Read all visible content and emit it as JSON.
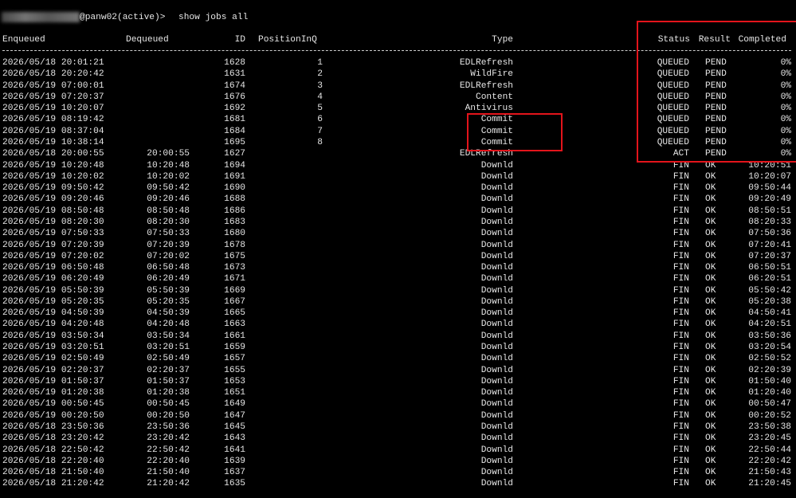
{
  "prompt": {
    "host_suffix": "@panw02(active)> ",
    "command": "show jobs all"
  },
  "headers": {
    "enqueued": "Enqueued",
    "dequeued": "Dequeued",
    "id": "ID",
    "position": "PositionInQ",
    "type": "Type",
    "status": "Status",
    "result": "Result",
    "completed": "Completed"
  },
  "separator": "------------------------------------------------------------------------------------------------------------------------------------",
  "colors": {
    "background": "#000000",
    "text": "#e6e6e6",
    "highlight_box": "#e3141b"
  },
  "rows": [
    {
      "enqueued": "2026/05/18 20:01:21",
      "dequeued": "",
      "id": "1628",
      "position": "1",
      "type": "EDLRefresh",
      "status": "QUEUED",
      "result": "PEND",
      "completed": "0%"
    },
    {
      "enqueued": "2026/05/18 20:20:42",
      "dequeued": "",
      "id": "1631",
      "position": "2",
      "type": "WildFire",
      "status": "QUEUED",
      "result": "PEND",
      "completed": "0%"
    },
    {
      "enqueued": "2026/05/19 07:00:01",
      "dequeued": "",
      "id": "1674",
      "position": "3",
      "type": "EDLRefresh",
      "status": "QUEUED",
      "result": "PEND",
      "completed": "0%"
    },
    {
      "enqueued": "2026/05/19 07:20:37",
      "dequeued": "",
      "id": "1676",
      "position": "4",
      "type": "Content",
      "status": "QUEUED",
      "result": "PEND",
      "completed": "0%"
    },
    {
      "enqueued": "2026/05/19 10:20:07",
      "dequeued": "",
      "id": "1692",
      "position": "5",
      "type": "Antivirus",
      "status": "QUEUED",
      "result": "PEND",
      "completed": "0%"
    },
    {
      "enqueued": "2026/05/19 08:19:42",
      "dequeued": "",
      "id": "1681",
      "position": "6",
      "type": "Commit",
      "status": "QUEUED",
      "result": "PEND",
      "completed": "0%"
    },
    {
      "enqueued": "2026/05/19 08:37:04",
      "dequeued": "",
      "id": "1684",
      "position": "7",
      "type": "Commit",
      "status": "QUEUED",
      "result": "PEND",
      "completed": "0%"
    },
    {
      "enqueued": "2026/05/19 10:38:14",
      "dequeued": "",
      "id": "1695",
      "position": "8",
      "type": "Commit",
      "status": "QUEUED",
      "result": "PEND",
      "completed": "0%"
    },
    {
      "enqueued": "2026/05/18 20:00:55",
      "dequeued": "20:00:55",
      "id": "1627",
      "position": "",
      "type": "EDLRefresh",
      "status": "ACT",
      "result": "PEND",
      "completed": "0%"
    },
    {
      "enqueued": "2026/05/19 10:20:48",
      "dequeued": "10:20:48",
      "id": "1694",
      "position": "",
      "type": "Downld",
      "status": "FIN",
      "result": "OK",
      "completed": "10:20:51"
    },
    {
      "enqueued": "2026/05/19 10:20:02",
      "dequeued": "10:20:02",
      "id": "1691",
      "position": "",
      "type": "Downld",
      "status": "FIN",
      "result": "OK",
      "completed": "10:20:07"
    },
    {
      "enqueued": "2026/05/19 09:50:42",
      "dequeued": "09:50:42",
      "id": "1690",
      "position": "",
      "type": "Downld",
      "status": "FIN",
      "result": "OK",
      "completed": "09:50:44"
    },
    {
      "enqueued": "2026/05/19 09:20:46",
      "dequeued": "09:20:46",
      "id": "1688",
      "position": "",
      "type": "Downld",
      "status": "FIN",
      "result": "OK",
      "completed": "09:20:49"
    },
    {
      "enqueued": "2026/05/19 08:50:48",
      "dequeued": "08:50:48",
      "id": "1686",
      "position": "",
      "type": "Downld",
      "status": "FIN",
      "result": "OK",
      "completed": "08:50:51"
    },
    {
      "enqueued": "2026/05/19 08:20:30",
      "dequeued": "08:20:30",
      "id": "1683",
      "position": "",
      "type": "Downld",
      "status": "FIN",
      "result": "OK",
      "completed": "08:20:33"
    },
    {
      "enqueued": "2026/05/19 07:50:33",
      "dequeued": "07:50:33",
      "id": "1680",
      "position": "",
      "type": "Downld",
      "status": "FIN",
      "result": "OK",
      "completed": "07:50:36"
    },
    {
      "enqueued": "2026/05/19 07:20:39",
      "dequeued": "07:20:39",
      "id": "1678",
      "position": "",
      "type": "Downld",
      "status": "FIN",
      "result": "OK",
      "completed": "07:20:41"
    },
    {
      "enqueued": "2026/05/19 07:20:02",
      "dequeued": "07:20:02",
      "id": "1675",
      "position": "",
      "type": "Downld",
      "status": "FIN",
      "result": "OK",
      "completed": "07:20:37"
    },
    {
      "enqueued": "2026/05/19 06:50:48",
      "dequeued": "06:50:48",
      "id": "1673",
      "position": "",
      "type": "Downld",
      "status": "FIN",
      "result": "OK",
      "completed": "06:50:51"
    },
    {
      "enqueued": "2026/05/19 06:20:49",
      "dequeued": "06:20:49",
      "id": "1671",
      "position": "",
      "type": "Downld",
      "status": "FIN",
      "result": "OK",
      "completed": "06:20:51"
    },
    {
      "enqueued": "2026/05/19 05:50:39",
      "dequeued": "05:50:39",
      "id": "1669",
      "position": "",
      "type": "Downld",
      "status": "FIN",
      "result": "OK",
      "completed": "05:50:42"
    },
    {
      "enqueued": "2026/05/19 05:20:35",
      "dequeued": "05:20:35",
      "id": "1667",
      "position": "",
      "type": "Downld",
      "status": "FIN",
      "result": "OK",
      "completed": "05:20:38"
    },
    {
      "enqueued": "2026/05/19 04:50:39",
      "dequeued": "04:50:39",
      "id": "1665",
      "position": "",
      "type": "Downld",
      "status": "FIN",
      "result": "OK",
      "completed": "04:50:41"
    },
    {
      "enqueued": "2026/05/19 04:20:48",
      "dequeued": "04:20:48",
      "id": "1663",
      "position": "",
      "type": "Downld",
      "status": "FIN",
      "result": "OK",
      "completed": "04:20:51"
    },
    {
      "enqueued": "2026/05/19 03:50:34",
      "dequeued": "03:50:34",
      "id": "1661",
      "position": "",
      "type": "Downld",
      "status": "FIN",
      "result": "OK",
      "completed": "03:50:36"
    },
    {
      "enqueued": "2026/05/19 03:20:51",
      "dequeued": "03:20:51",
      "id": "1659",
      "position": "",
      "type": "Downld",
      "status": "FIN",
      "result": "OK",
      "completed": "03:20:54"
    },
    {
      "enqueued": "2026/05/19 02:50:49",
      "dequeued": "02:50:49",
      "id": "1657",
      "position": "",
      "type": "Downld",
      "status": "FIN",
      "result": "OK",
      "completed": "02:50:52"
    },
    {
      "enqueued": "2026/05/19 02:20:37",
      "dequeued": "02:20:37",
      "id": "1655",
      "position": "",
      "type": "Downld",
      "status": "FIN",
      "result": "OK",
      "completed": "02:20:39"
    },
    {
      "enqueued": "2026/05/19 01:50:37",
      "dequeued": "01:50:37",
      "id": "1653",
      "position": "",
      "type": "Downld",
      "status": "FIN",
      "result": "OK",
      "completed": "01:50:40"
    },
    {
      "enqueued": "2026/05/19 01:20:38",
      "dequeued": "01:20:38",
      "id": "1651",
      "position": "",
      "type": "Downld",
      "status": "FIN",
      "result": "OK",
      "completed": "01:20:40"
    },
    {
      "enqueued": "2026/05/19 00:50:45",
      "dequeued": "00:50:45",
      "id": "1649",
      "position": "",
      "type": "Downld",
      "status": "FIN",
      "result": "OK",
      "completed": "00:50:47"
    },
    {
      "enqueued": "2026/05/19 00:20:50",
      "dequeued": "00:20:50",
      "id": "1647",
      "position": "",
      "type": "Downld",
      "status": "FIN",
      "result": "OK",
      "completed": "00:20:52"
    },
    {
      "enqueued": "2026/05/18 23:50:36",
      "dequeued": "23:50:36",
      "id": "1645",
      "position": "",
      "type": "Downld",
      "status": "FIN",
      "result": "OK",
      "completed": "23:50:38"
    },
    {
      "enqueued": "2026/05/18 23:20:42",
      "dequeued": "23:20:42",
      "id": "1643",
      "position": "",
      "type": "Downld",
      "status": "FIN",
      "result": "OK",
      "completed": "23:20:45"
    },
    {
      "enqueued": "2026/05/18 22:50:42",
      "dequeued": "22:50:42",
      "id": "1641",
      "position": "",
      "type": "Downld",
      "status": "FIN",
      "result": "OK",
      "completed": "22:50:44"
    },
    {
      "enqueued": "2026/05/18 22:20:40",
      "dequeued": "22:20:40",
      "id": "1639",
      "position": "",
      "type": "Downld",
      "status": "FIN",
      "result": "OK",
      "completed": "22:20:42"
    },
    {
      "enqueued": "2026/05/18 21:50:40",
      "dequeued": "21:50:40",
      "id": "1637",
      "position": "",
      "type": "Downld",
      "status": "FIN",
      "result": "OK",
      "completed": "21:50:43"
    },
    {
      "enqueued": "2026/05/18 21:20:42",
      "dequeued": "21:20:42",
      "id": "1635",
      "position": "",
      "type": "Downld",
      "status": "FIN",
      "result": "OK",
      "completed": "21:20:45"
    }
  ]
}
